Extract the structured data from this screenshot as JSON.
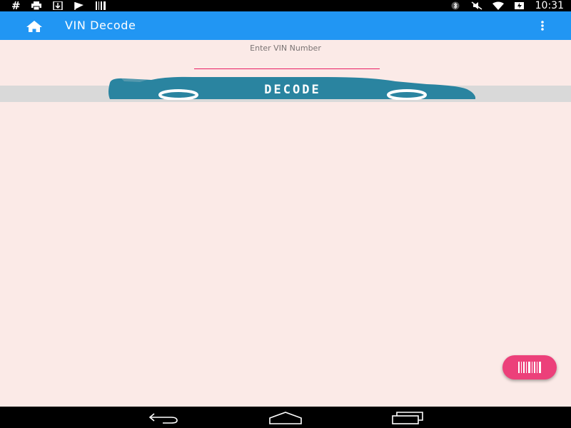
{
  "status_bar": {
    "left_icons": [
      "hash-icon",
      "printer-icon",
      "download-icon",
      "debug-flag-icon",
      "barcode-notification-icon"
    ],
    "right_icons": [
      "bluetooth-icon",
      "mute-icon",
      "wifi-icon",
      "battery-icon"
    ],
    "time": "10:31",
    "hash_glyph": "#"
  },
  "app_bar": {
    "title": "VIN Decode",
    "home_icon": "home-icon",
    "menu_icon": "overflow-menu-icon",
    "color": "#2196f3"
  },
  "vin": {
    "label": "Enter VIN Number",
    "value": "",
    "underline_color": "#e91e63"
  },
  "decode_button": {
    "label": "DECODE",
    "car_color": "#2a84a0"
  },
  "fab": {
    "icon": "barcode-scan-icon",
    "color": "#ec407a"
  },
  "nav_bar": {
    "icons": [
      "back-icon",
      "home-nav-icon",
      "recent-apps-icon"
    ]
  },
  "background": "#fbeae7"
}
